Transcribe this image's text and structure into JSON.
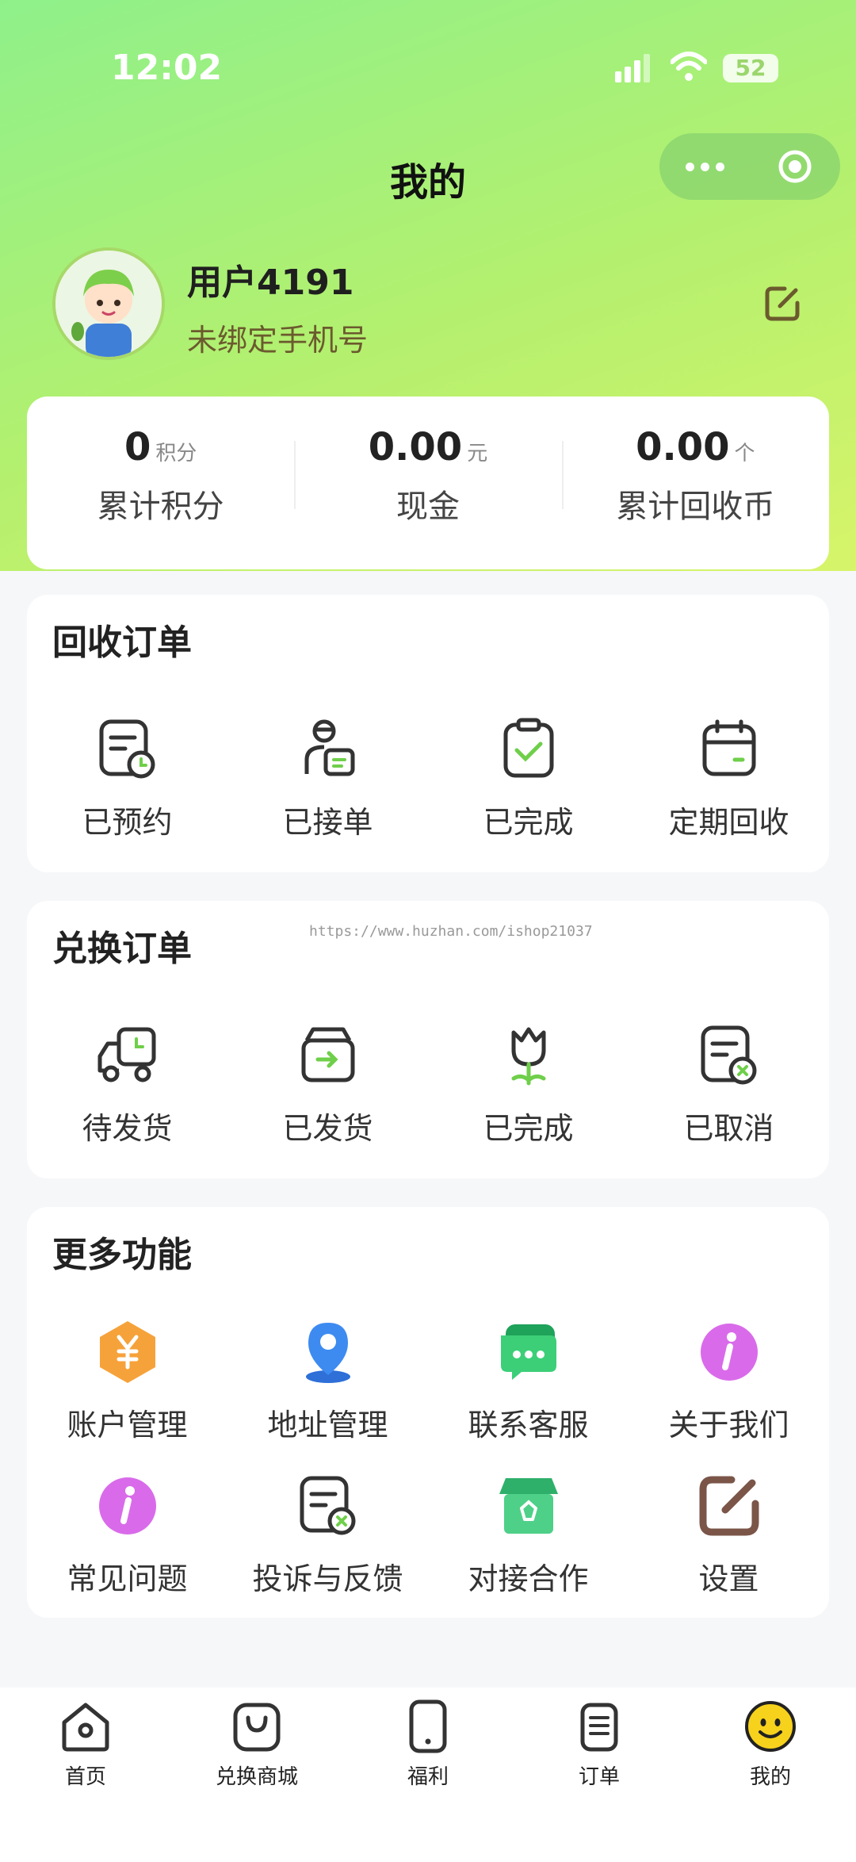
{
  "status_bar": {
    "time": "12:02",
    "battery": "52"
  },
  "header": {
    "title": "我的"
  },
  "profile": {
    "username": "用户4191",
    "phone": "未绑定手机号"
  },
  "stats": [
    {
      "value": "0",
      "unit": "积分",
      "label": "累计积分"
    },
    {
      "value": "0.00",
      "unit": "元",
      "label": "现金"
    },
    {
      "value": "0.00",
      "unit": "个",
      "label": "累计回收币"
    }
  ],
  "recycle_orders": {
    "title": "回收订单",
    "items": [
      {
        "label": "已预约",
        "icon": "calendar-clock-icon"
      },
      {
        "label": "已接单",
        "icon": "courier-icon"
      },
      {
        "label": "已完成",
        "icon": "clipboard-check-icon"
      },
      {
        "label": "定期回收",
        "icon": "calendar-icon"
      }
    ]
  },
  "exchange_orders": {
    "title": "兑换订单",
    "items": [
      {
        "label": "待发货",
        "icon": "delivery-truck-icon"
      },
      {
        "label": "已发货",
        "icon": "box-arrow-icon"
      },
      {
        "label": "已完成",
        "icon": "tulip-icon"
      },
      {
        "label": "已取消",
        "icon": "document-cancel-icon"
      }
    ]
  },
  "watermark": "https://www.huzhan.com/ishop21037",
  "more": {
    "title": "更多功能",
    "items": [
      {
        "label": "账户管理",
        "icon": "yuan-hexagon-icon"
      },
      {
        "label": "地址管理",
        "icon": "location-pin-icon"
      },
      {
        "label": "联系客服",
        "icon": "chat-bubble-icon"
      },
      {
        "label": "关于我们",
        "icon": "info-icon"
      },
      {
        "label": "常见问题",
        "icon": "info-icon"
      },
      {
        "label": "投诉与反馈",
        "icon": "document-cancel-icon"
      },
      {
        "label": "对接合作",
        "icon": "recycle-store-icon"
      },
      {
        "label": "设置",
        "icon": "edit-square-icon"
      }
    ]
  },
  "tabbar": [
    {
      "label": "首页",
      "icon": "home-icon"
    },
    {
      "label": "兑换商城",
      "icon": "shopping-bag-icon"
    },
    {
      "label": "福利",
      "icon": "phone-icon"
    },
    {
      "label": "订单",
      "icon": "order-list-icon"
    },
    {
      "label": "我的",
      "icon": "smiley-icon",
      "active": true
    }
  ],
  "colors": {
    "gradient_start": "#8ff08a",
    "gradient_end": "#d7f46a",
    "accent_green": "#6fcf4a",
    "icon_dark": "#3a3a3a",
    "active_tab": "#f7d21c"
  }
}
